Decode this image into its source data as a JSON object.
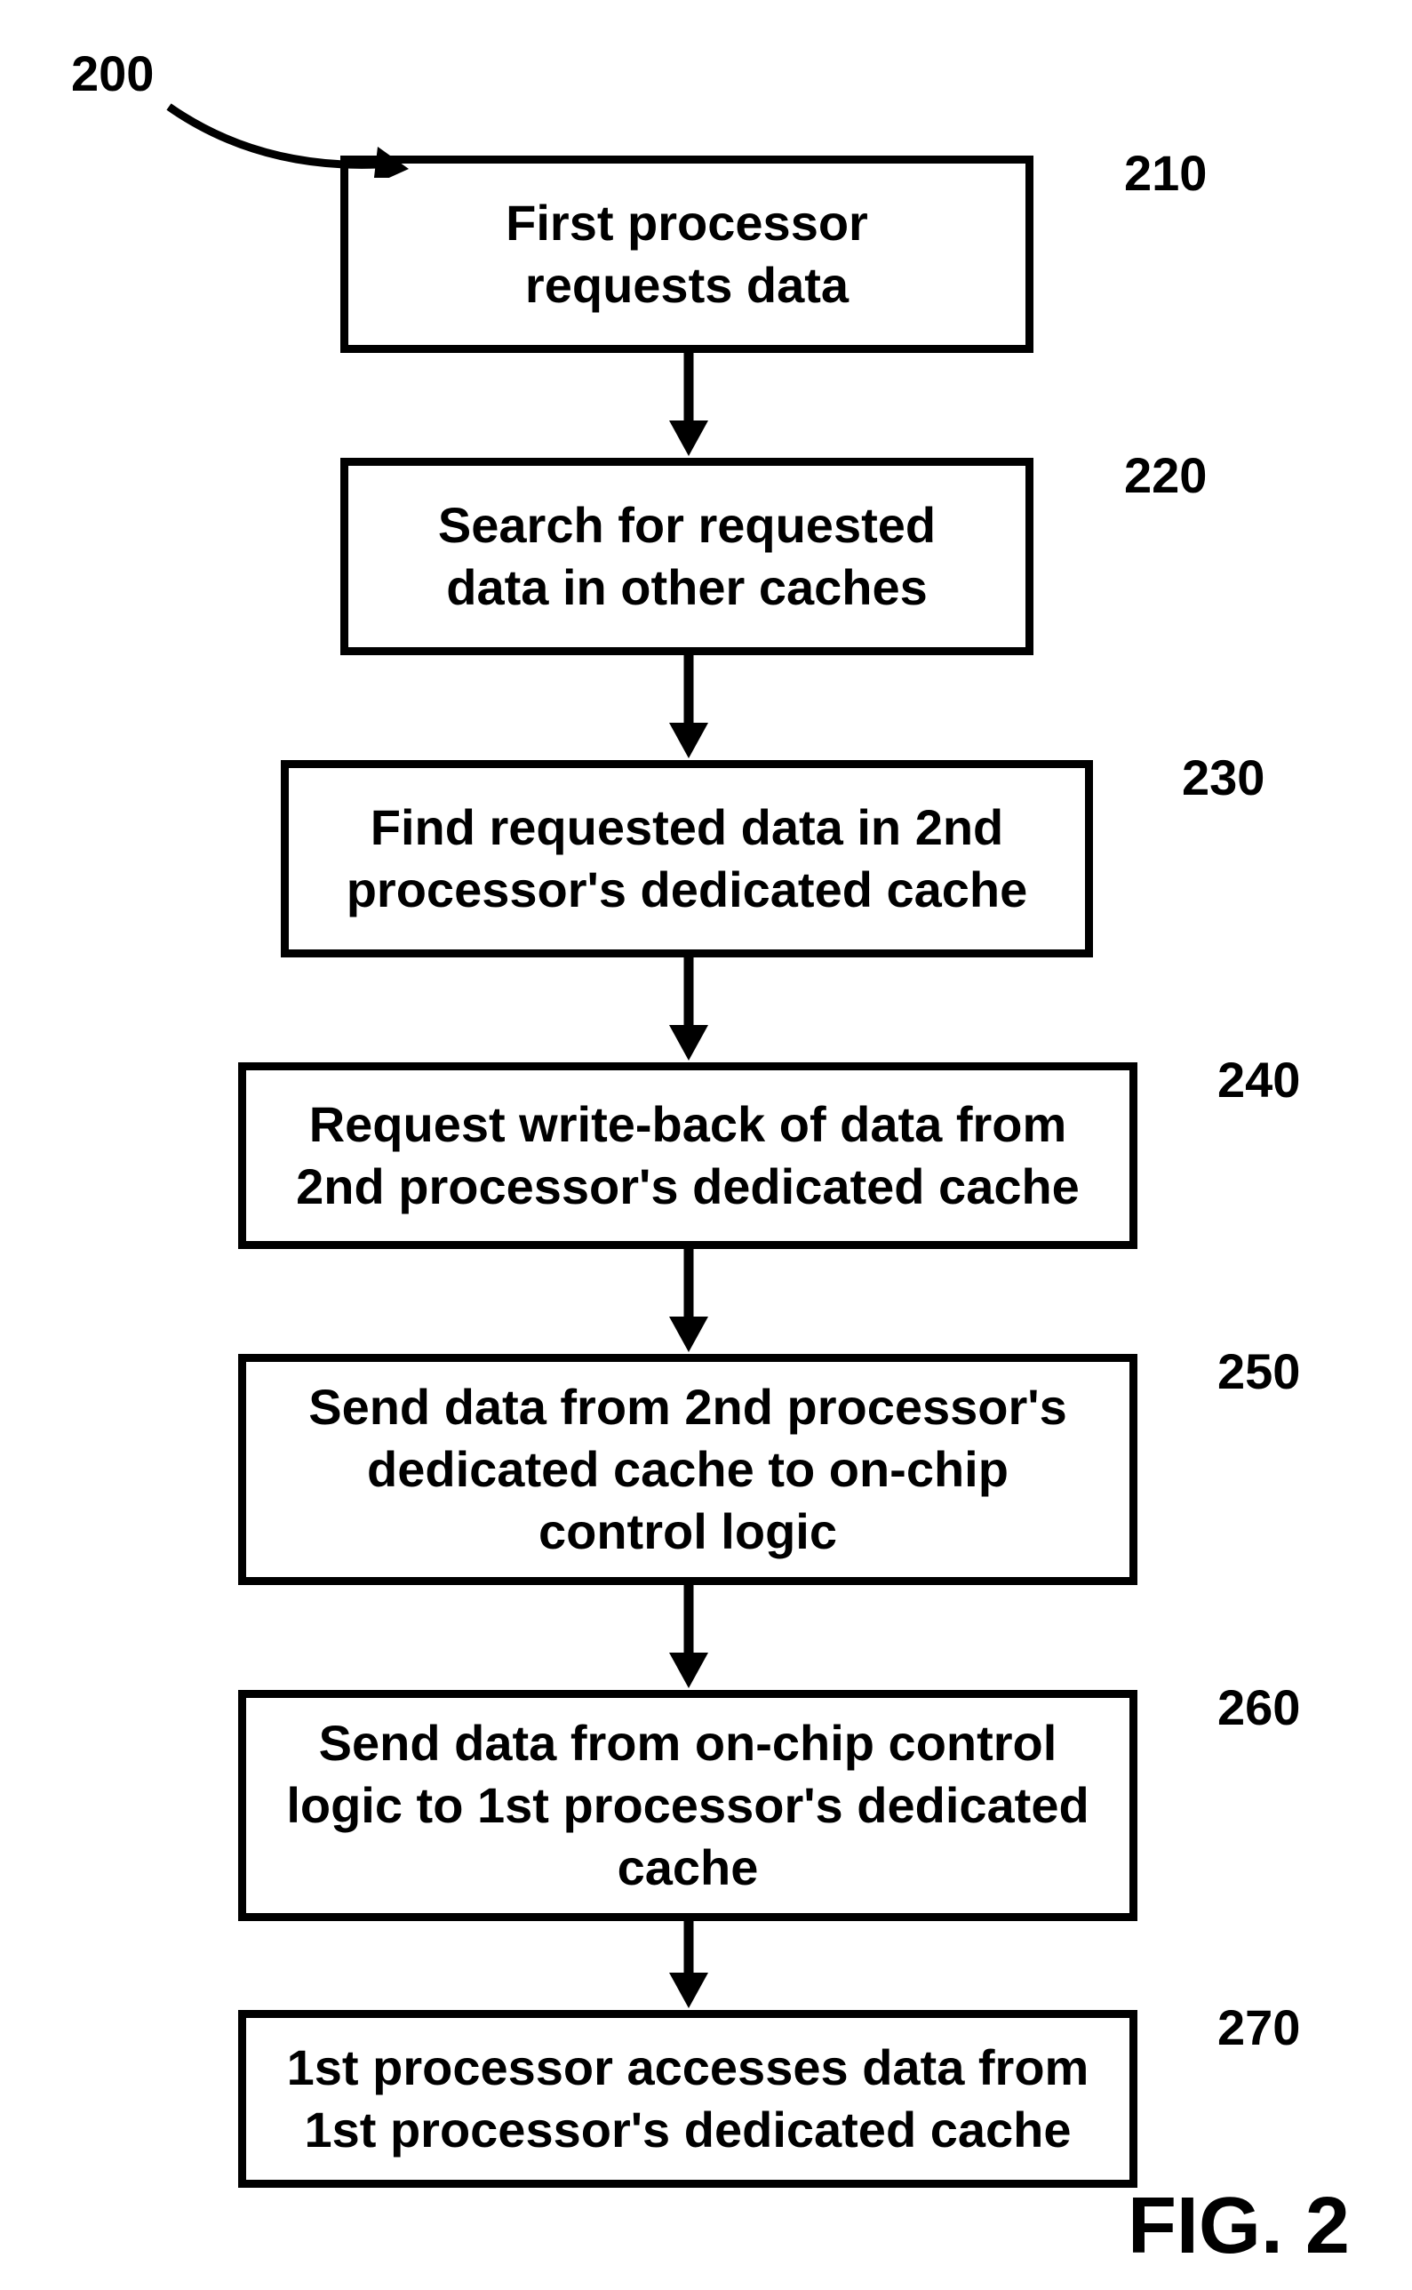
{
  "figure": {
    "title_ref": "200",
    "caption": "FIG. 2",
    "steps": [
      {
        "ref": "210",
        "text": "First processor\nrequests data"
      },
      {
        "ref": "220",
        "text": "Search for requested\ndata in other caches"
      },
      {
        "ref": "230",
        "text": "Find requested data in 2nd\nprocessor's dedicated cache"
      },
      {
        "ref": "240",
        "text": "Request write-back of data from\n2nd processor's dedicated cache"
      },
      {
        "ref": "250",
        "text": "Send data from 2nd processor's\ndedicated cache to on-chip\ncontrol logic"
      },
      {
        "ref": "260",
        "text": "Send data from on-chip control\nlogic to 1st processor's dedicated\ncache"
      },
      {
        "ref": "270",
        "text": "1st processor accesses data from\n1st processor's dedicated cache"
      }
    ]
  }
}
